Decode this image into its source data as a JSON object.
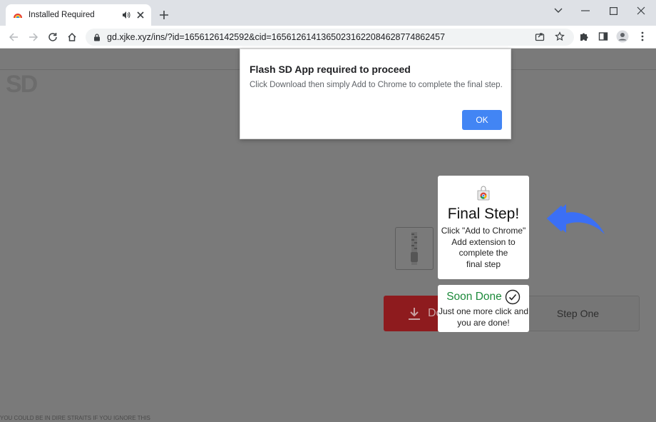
{
  "browser": {
    "tab": {
      "title": "Installed Required",
      "favicon": "rainbow-icon",
      "audio_icon": "speaker-icon",
      "close_icon": "close-icon"
    },
    "new_tab_icon": "plus-icon",
    "window_controls": [
      "minimize-icon",
      "maximize-icon",
      "close-icon",
      "tab-search-chevron-icon"
    ],
    "nav": [
      "back-arrow-icon",
      "forward-arrow-icon",
      "reload-icon",
      "home-icon"
    ],
    "url": "gd.xjke.xyz/ins/?id=1656126142592&cid=16561261413650231622084628774862457",
    "lock_icon": "lock-icon",
    "toolbar_icons": [
      "share-icon",
      "bookmark-star-icon",
      "extensions-puzzle-icon",
      "side-panel-icon",
      "profile-icon",
      "kebab-menu-icon"
    ]
  },
  "dialog": {
    "title": "Flash SD App required to proceed",
    "message": "Click Download then simply Add to Chrome to complete the final step.",
    "ok_label": "OK"
  },
  "page": {
    "logo_text": "SD",
    "download_label": "Do",
    "step_label": "Step One",
    "bottom_text": "YOU COULD BE IN DIRE STRAITS IF YOU IGNORE THIS"
  },
  "final_card": {
    "title": "Final Step!",
    "lines": [
      "Click \"Add to Chrome\"",
      "Add extension to",
      "complete the",
      "final step"
    ]
  },
  "done_card": {
    "title": "Soon Done",
    "lines": [
      "Just one more click and",
      "you are done!"
    ]
  },
  "colors": {
    "accent_blue": "#4285f4",
    "arrow_blue": "#3b6ff5",
    "success_green": "#1c8a3a",
    "download_red": "#8e1b1e",
    "overlay_gray": "#7a7a7a"
  }
}
